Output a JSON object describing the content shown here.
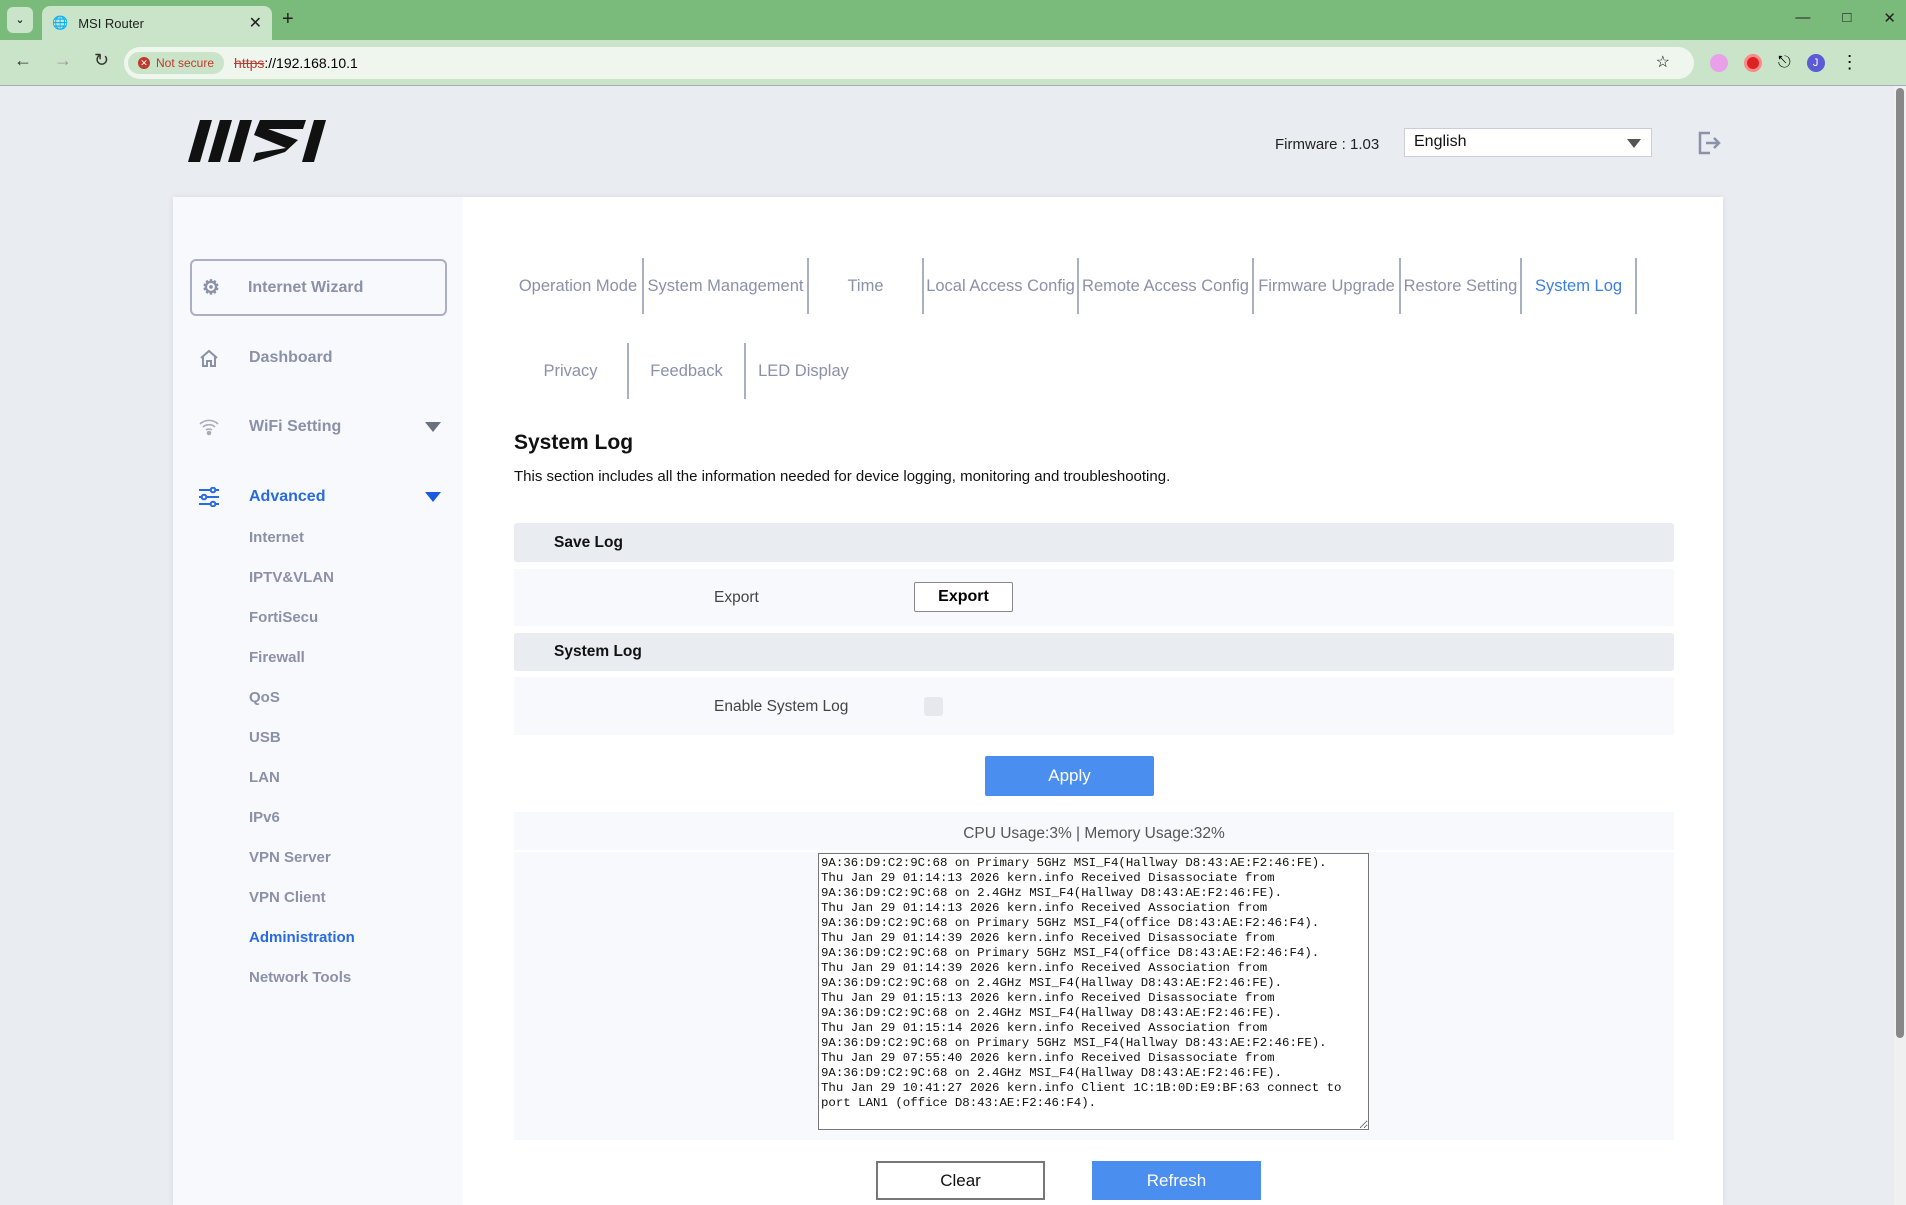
{
  "browser": {
    "tab_title": "MSI Router",
    "security": "Not secure",
    "url_scheme": "https",
    "url_rest": "://192.168.10.1",
    "profile_initial": "J"
  },
  "header": {
    "logo": "MSI",
    "firmware": "Firmware : 1.03",
    "language": "English"
  },
  "sidebar": {
    "wizard": "Internet Wizard",
    "items": [
      {
        "label": "Dashboard"
      },
      {
        "label": "WiFi Setting"
      },
      {
        "label": "Advanced"
      }
    ],
    "sub_items": [
      "Internet",
      "IPTV&VLAN",
      "FortiSecu",
      "Firewall",
      "QoS",
      "USB",
      "LAN",
      "IPv6",
      "VPN Server",
      "VPN Client",
      "Administration",
      "Network Tools"
    ],
    "active_sub": "Administration"
  },
  "tabs_row1": [
    "Operation Mode",
    "System Management",
    "Time",
    "Local Access Config",
    "Remote Access Config",
    "Firmware Upgrade",
    "Restore Setting",
    "System Log"
  ],
  "tabs_row2": [
    "Privacy",
    "Feedback",
    "LED Display"
  ],
  "active_tab": "System Log",
  "main": {
    "title": "System Log",
    "description": "This section includes all the information needed for device logging, monitoring and troubleshooting.",
    "save_log": {
      "header": "Save Log",
      "label": "Export",
      "button": "Export"
    },
    "system_log": {
      "header": "System Log",
      "label": "Enable System Log",
      "enabled": false
    },
    "apply": "Apply",
    "usage": "CPU Usage:3% | Memory Usage:32%",
    "log": "9A:36:D9:C2:9C:68 on Primary 5GHz MSI_F4(Hallway D8:43:AE:F2:46:FE).\nThu Jan 29 01:14:13 2026 kern.info Received Disassociate from\n9A:36:D9:C2:9C:68 on 2.4GHz MSI_F4(Hallway D8:43:AE:F2:46:FE).\nThu Jan 29 01:14:13 2026 kern.info Received Association from\n9A:36:D9:C2:9C:68 on Primary 5GHz MSI_F4(office D8:43:AE:F2:46:F4).\nThu Jan 29 01:14:39 2026 kern.info Received Disassociate from\n9A:36:D9:C2:9C:68 on Primary 5GHz MSI_F4(office D8:43:AE:F2:46:F4).\nThu Jan 29 01:14:39 2026 kern.info Received Association from\n9A:36:D9:C2:9C:68 on 2.4GHz MSI_F4(Hallway D8:43:AE:F2:46:FE).\nThu Jan 29 01:15:13 2026 kern.info Received Disassociate from\n9A:36:D9:C2:9C:68 on 2.4GHz MSI_F4(Hallway D8:43:AE:F2:46:FE).\nThu Jan 29 01:15:14 2026 kern.info Received Association from\n9A:36:D9:C2:9C:68 on Primary 5GHz MSI_F4(Hallway D8:43:AE:F2:46:FE).\nThu Jan 29 07:55:40 2026 kern.info Received Disassociate from\n9A:36:D9:C2:9C:68 on 2.4GHz MSI_F4(Hallway D8:43:AE:F2:46:FE).\nThu Jan 29 10:41:27 2026 kern.info Client 1C:1B:0D:E9:BF:63 connect to\nport LAN1 (office D8:43:AE:F2:46:F4).\n",
    "clear": "Clear",
    "refresh": "Refresh"
  },
  "colors": {
    "accent": "#3d7fe0",
    "browser_frame": "#7aba7a"
  }
}
